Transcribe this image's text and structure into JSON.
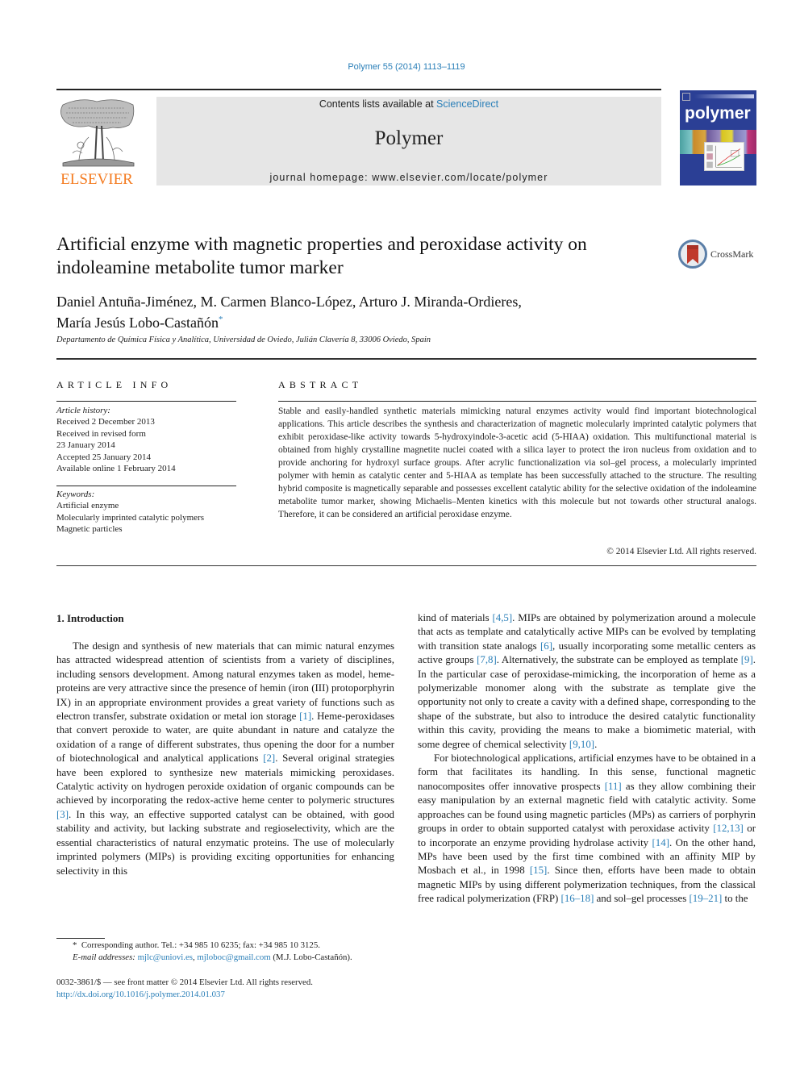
{
  "header": {
    "citation": "Polymer 55 (2014) 1113–1119",
    "contents_prefix": "Contents lists available at ",
    "contents_link": "ScienceDirect",
    "journal_name": "Polymer",
    "homepage_line": "journal homepage: www.elsevier.com/locate/polymer",
    "publisher_logo_text": "ELSEVIER",
    "cover_title": "polymer",
    "crossmark_label": "CrossMark"
  },
  "article": {
    "title": "Artificial enzyme with magnetic properties and peroxidase activity on indoleamine metabolite tumor marker",
    "authors": "Daniel Antuña-Jiménez, M. Carmen Blanco-López, Arturo J. Miranda-Ordieres, María Jesús Lobo-Castañón",
    "authors_line1": "Daniel Antuña-Jiménez, M. Carmen Blanco-López, Arturo J. Miranda-Ordieres,",
    "authors_line2": "María Jesús Lobo-Castañón",
    "corresponding_mark": "*",
    "affiliation": "Departamento de Química Física y Analítica, Universidad de Oviedo, Julián Clavería 8, 33006 Oviedo, Spain"
  },
  "article_info": {
    "heading": "ARTICLE INFO",
    "history_label": "Article history:",
    "history": [
      "Received 2 December 2013",
      "Received in revised form",
      "23 January 2014",
      "Accepted 25 January 2014",
      "Available online 1 February 2014"
    ],
    "keywords_label": "Keywords:",
    "keywords": [
      "Artificial enzyme",
      "Molecularly imprinted catalytic polymers",
      "Magnetic particles"
    ]
  },
  "abstract": {
    "heading": "ABSTRACT",
    "text": "Stable and easily-handled synthetic materials mimicking natural enzymes activity would find important biotechnological applications. This article describes the synthesis and characterization of magnetic molecularly imprinted catalytic polymers that exhibit peroxidase-like activity towards 5-hydroxyindole-3-acetic acid (5-HIAA) oxidation. This multifunctional material is obtained from highly crystalline magnetite nuclei coated with a silica layer to protect the iron nucleus from oxidation and to provide anchoring for hydroxyl surface groups. After acrylic functionalization via sol–gel process, a molecularly imprinted polymer with hemin as catalytic center and 5-HIAA as template has been successfully attached to the structure. The resulting hybrid composite is magnetically separable and possesses excellent catalytic ability for the selective oxidation of the indoleamine metabolite tumor marker, showing Michaelis–Menten kinetics with this molecule but not towards other structural analogs. Therefore, it can be considered an artificial peroxidase enzyme.",
    "copyright": "© 2014 Elsevier Ltd. All rights reserved."
  },
  "introduction": {
    "heading": "1.  Introduction",
    "left_paragraph": [
      {
        "t": "The design and synthesis of new materials that can mimic natural enzymes has attracted widespread attention of scientists from a variety of disciplines, including sensors development. Among natural enzymes taken as model, heme-proteins are very attractive since the presence of hemin (iron (III) protoporphyrin IX) in an appropriate environment provides a great variety of functions such as electron transfer, substrate oxidation or metal ion storage "
      },
      {
        "ref": "[1]"
      },
      {
        "t": ". Heme-peroxidases that convert peroxide to water, are quite abundant in nature and catalyze the oxidation of a range of different substrates, thus opening the door for a number of biotechnological and analytical applications "
      },
      {
        "ref": "[2]"
      },
      {
        "t": ". Several original strategies have been explored to synthesize new materials mimicking peroxidases. Catalytic activity on hydrogen peroxide oxidation of organic compounds can be achieved by incorporating the redox-active heme center to polymeric structures "
      },
      {
        "ref": "[3]"
      },
      {
        "t": ". In this way, an effective supported catalyst can be obtained, with good stability and activity, but lacking substrate and regioselectivity, which are the essential characteristics of natural enzymatic proteins. The use of molecularly imprinted polymers (MIPs) is providing exciting opportunities for enhancing selectivity in this"
      }
    ],
    "right_paragraph_1": [
      {
        "t": "kind of materials "
      },
      {
        "ref": "[4,5]"
      },
      {
        "t": ". MIPs are obtained by polymerization around a molecule that acts as template and catalytically active MIPs can be evolved by templating with transition state analogs "
      },
      {
        "ref": "[6]"
      },
      {
        "t": ", usually incorporating some metallic centers as active groups "
      },
      {
        "ref": "[7,8]"
      },
      {
        "t": ". Alternatively, the substrate can be employed as template "
      },
      {
        "ref": "[9]"
      },
      {
        "t": ". In the particular case of peroxidase-mimicking, the incorporation of heme as a polymerizable monomer along with the substrate as template give the opportunity not only to create a cavity with a defined shape, corresponding to the shape of the substrate, but also to introduce the desired catalytic functionality within this cavity, providing the means to make a biomimetic material, with some degree of chemical selectivity "
      },
      {
        "ref": "[9,10]"
      },
      {
        "t": "."
      }
    ],
    "right_paragraph_2": [
      {
        "t": "For biotechnological applications, artificial enzymes have to be obtained in a form that facilitates its handling. In this sense, functional magnetic nanocomposites offer innovative prospects "
      },
      {
        "ref": "[11]"
      },
      {
        "t": " as they allow combining their easy manipulation by an external magnetic field with catalytic activity. Some approaches can be found using magnetic particles (MPs) as carriers of porphyrin groups in order to obtain supported catalyst with peroxidase activity "
      },
      {
        "ref": "[12,13]"
      },
      {
        "t": " or to incorporate an enzyme providing hydrolase activity "
      },
      {
        "ref": "[14]"
      },
      {
        "t": ". On the other hand, MPs have been used by the first time combined with an affinity MIP by Mosbach et al., in 1998 "
      },
      {
        "ref": "[15]"
      },
      {
        "t": ". Since then, efforts have been made to obtain magnetic MIPs by using different polymerization techniques, from the classical free radical polymerization (FRP) "
      },
      {
        "ref": "[16–18]"
      },
      {
        "t": " and sol–gel processes "
      },
      {
        "ref": "[19–21]"
      },
      {
        "t": " to the"
      }
    ]
  },
  "footnote": {
    "mark": "*",
    "corresponding": "Corresponding author. Tel.: +34 985 10 6235; fax: +34 985 10 3125.",
    "email_label": "E-mail addresses:",
    "email_1": "mjlc@uniovi.es",
    "email_sep": ", ",
    "email_2": "mjloboc@gmail.com",
    "email_suffix": " (M.J. Lobo-Castañón).",
    "issn_line": "0032-3861/$ — see front matter © 2014 Elsevier Ltd. All rights reserved.",
    "doi": "http://dx.doi.org/10.1016/j.polymer.2014.01.037"
  },
  "colors": {
    "link": "#2a7fb8",
    "elsevier_orange": "#f47b20",
    "cover_blue": "#2b3f95",
    "masthead_gray": "#e6e6e6"
  },
  "icons": {
    "publisher_logo": "elsevier-tree-logo",
    "journal_cover": "polymer-cover-thumbnail",
    "crossmark": "crossmark-icon"
  }
}
